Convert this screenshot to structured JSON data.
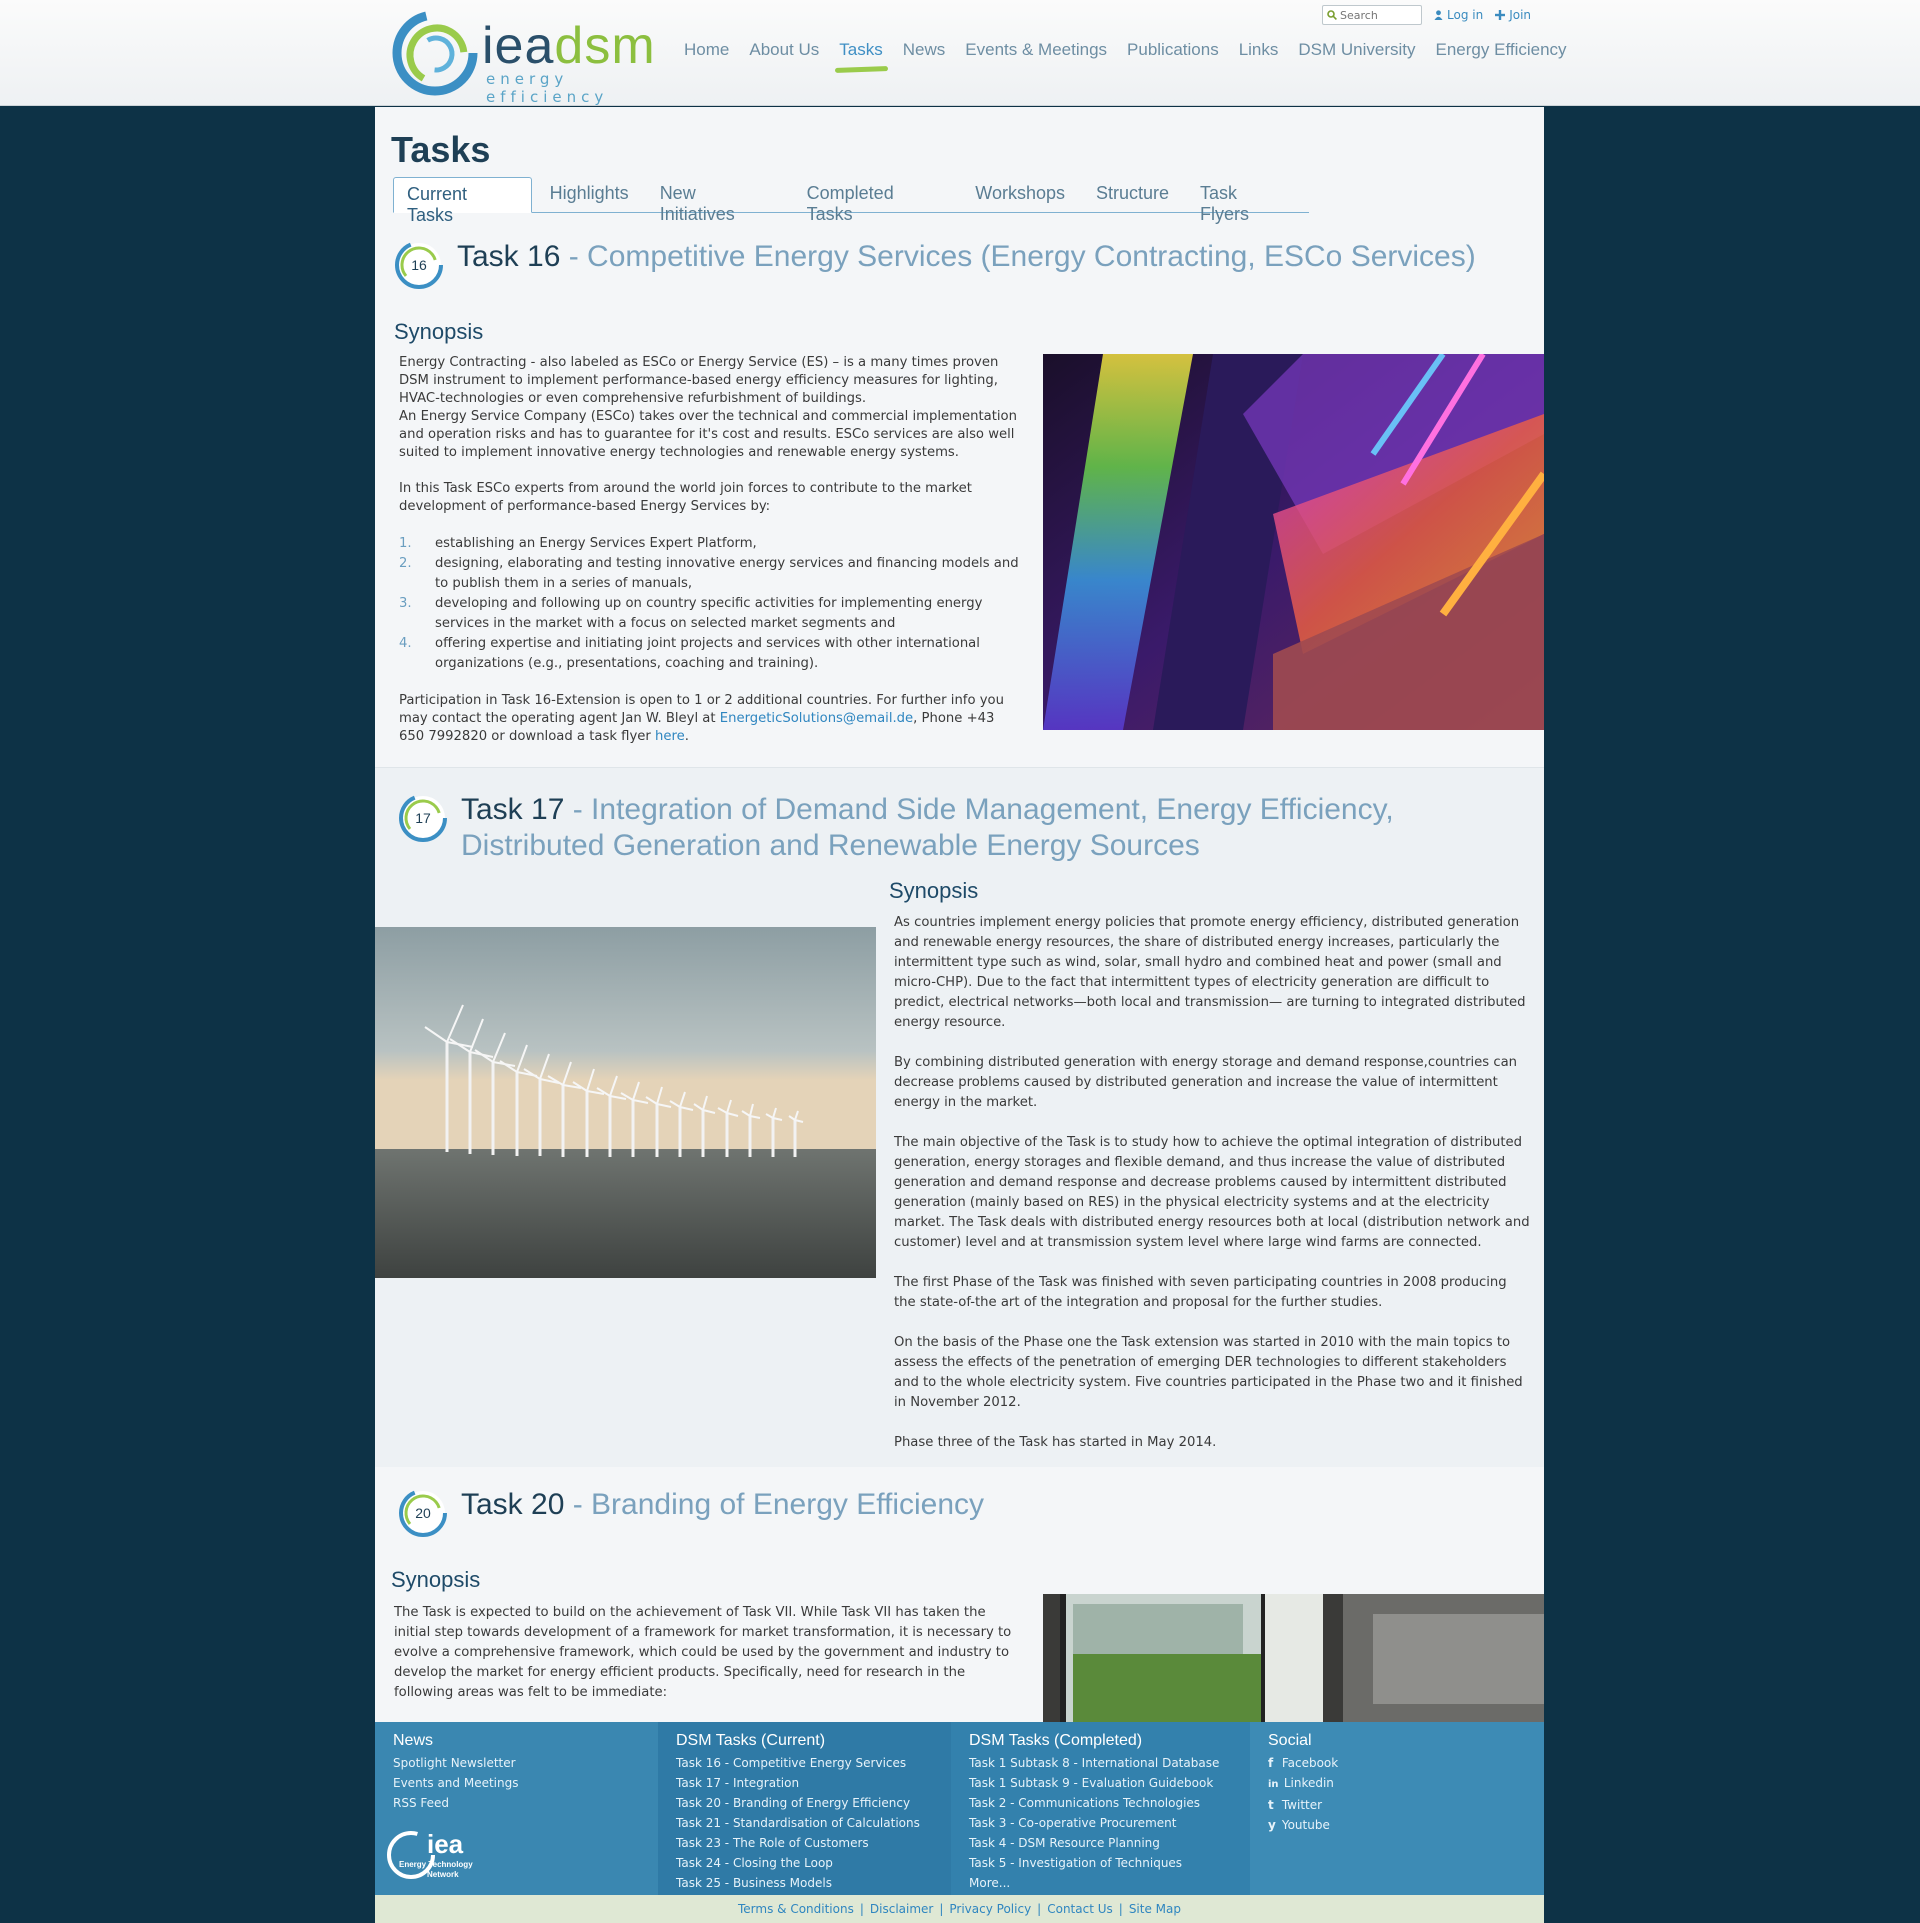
{
  "header": {
    "logo_iea": "iea",
    "logo_dsm": "dsm",
    "logo_sub": "energy efficiency",
    "search_placeholder": "Search",
    "login": "Log in",
    "join": "Join",
    "nav": [
      "Home",
      "About Us",
      "Tasks",
      "News",
      "Events & Meetings",
      "Publications",
      "Links",
      "DSM University",
      "Energy Efficiency"
    ],
    "active_nav": "Tasks"
  },
  "page": {
    "title": "Tasks",
    "tabs": [
      "Current Tasks",
      "Highlights",
      "New Initiatives",
      "Completed Tasks",
      "Workshops",
      "Structure",
      "Task Flyers"
    ]
  },
  "task16": {
    "badge": "16",
    "num": "Task 16",
    "sub": " - Competitive Energy Services (Energy Contracting, ESCo Services)",
    "synopsis": "Synopsis",
    "p1": "Energy Contracting - also labeled as ESCo or Energy Service (ES) – is a many times proven DSM instrument to implement performance-based energy efficiency measures for lighting, HVAC-technologies or even comprehensive refurbishment of buildings.",
    "p1b": "An Energy Service Company (ESCo) takes over the technical and commercial implementation and operation risks and has to guarantee for it's cost and results. ESCo services are also well suited to implement innovative energy technologies and renewable energy systems.",
    "p2": "In this Task ESCo experts from around the world join forces to contribute to the market development of performance-based Energy Services by:",
    "list": [
      {
        "n": "1.",
        "t": "establishing an Energy Services Expert Platform,"
      },
      {
        "n": "2.",
        "t": "designing, elaborating and testing innovative energy services and financing models and to publish them in a series of manuals,"
      },
      {
        "n": "3.",
        "t": "developing and following up on country specific activities for implementing energy services in the market with a focus on selected market segments and"
      },
      {
        "n": "4.",
        "t": "offering expertise and initiating joint projects and services with other international organizations (e.g., presentations, coaching and training)."
      }
    ],
    "p3a": "Participation in Task 16-Extension is open to 1 or 2 additional countries. For further info you may contact the operating agent Jan W. Bleyl at ",
    "email": "EnergeticSolutions@email.de",
    "p3b": ", Phone +43 650 7992820 or download a task flyer ",
    "here": "here",
    "p3c": "."
  },
  "task17": {
    "badge": "17",
    "num": "Task 17",
    "sub": " - Integration of Demand Side Management, Energy Efficiency, Distributed Generation and Renewable Energy Sources",
    "synopsis": "Synopsis",
    "paras": [
      "As countries implement energy policies that promote energy efficiency, distributed generation and renewable energy resources, the share of distributed energy increases, particularly the intermittent type such as wind, solar, small hydro and combined heat and power (small and micro-CHP). Due to the fact that intermittent types of electricity generation are difficult to predict, electrical networks—both local and transmission— are turning to integrated distributed energy resource.",
      "By combining distributed generation with energy storage and demand response,countries can decrease problems caused by distributed generation and increase the value of intermittent energy in the market.",
      "The main objective of the Task is to study how to achieve the optimal integration of distributed generation, energy storages and flexible demand, and thus increase the value of distributed generation and demand response and decrease problems caused by intermittent distributed generation (mainly based on RES) in the physical electricity systems and at the electricity market. The Task deals with distributed energy resources both at local (distribution network and customer) level and at transmission system level where large wind farms are connected.",
      "The first Phase of the Task was finished with seven participating countries in 2008 producing the state-of-the art of the integration and proposal for the further studies.",
      "On the basis of the Phase one the Task extension was started in 2010 with the main topics to assess the effects of the penetration of emerging DER technologies to different stakeholders and to the whole electricity system. Five countries participated in the Phase two and it finished in November 2012.",
      "Phase three of the Task has started in May 2014."
    ]
  },
  "task20": {
    "badge": "20",
    "num": "Task 20",
    "sub": " - Branding of Energy Efficiency",
    "synopsis": "Synopsis",
    "p1": "The Task is expected to build on the achievement of Task VII. While Task VII has taken the initial step towards development of a framework for market transformation, it is necessary to evolve a comprehensive framework, which could be used by the government and industry to develop the market for energy efficient products. Specifically, need for research in the following areas was felt to be immediate:"
  },
  "footer": {
    "news": {
      "title": "News",
      "items": [
        "Spotlight Newsletter",
        "Events and Meetings",
        "RSS Feed"
      ]
    },
    "current": {
      "title": "DSM Tasks (Current)",
      "items": [
        "Task 16 - Competitive Energy Services",
        "Task 17 - Integration",
        "Task 20 - Branding of Energy Efficiency",
        "Task 21 - Standardisation of Calculations",
        "Task 23 - The Role of Customers",
        "Task 24 - Closing the Loop",
        "Task 25 - Business Models"
      ]
    },
    "completed": {
      "title": "DSM Tasks (Completed)",
      "items": [
        "Task 1 Subtask 8 - International Database",
        "Task 1 Subtask 9 - Evaluation Guidebook",
        "Task 2 - Communications Technologies",
        "Task 3 - Co-operative Procurement",
        "Task 4 - DSM Resource Planning",
        "Task 5 - Investigation of Techniques",
        "More..."
      ]
    },
    "social": {
      "title": "Social",
      "items": [
        {
          "icon": "f",
          "label": "Facebook"
        },
        {
          "icon": "in",
          "label": "Linkedin"
        },
        {
          "icon": "t",
          "label": "Twitter"
        },
        {
          "icon": "y",
          "label": "Youtube"
        }
      ]
    },
    "iea_logo": "iea",
    "iea_logo_sub1": "Energy Technology",
    "iea_logo_sub2": "Network",
    "bottom": [
      "Terms & Conditions",
      "Disclaimer",
      "Privacy Policy",
      "Contact Us",
      "Site Map"
    ]
  }
}
